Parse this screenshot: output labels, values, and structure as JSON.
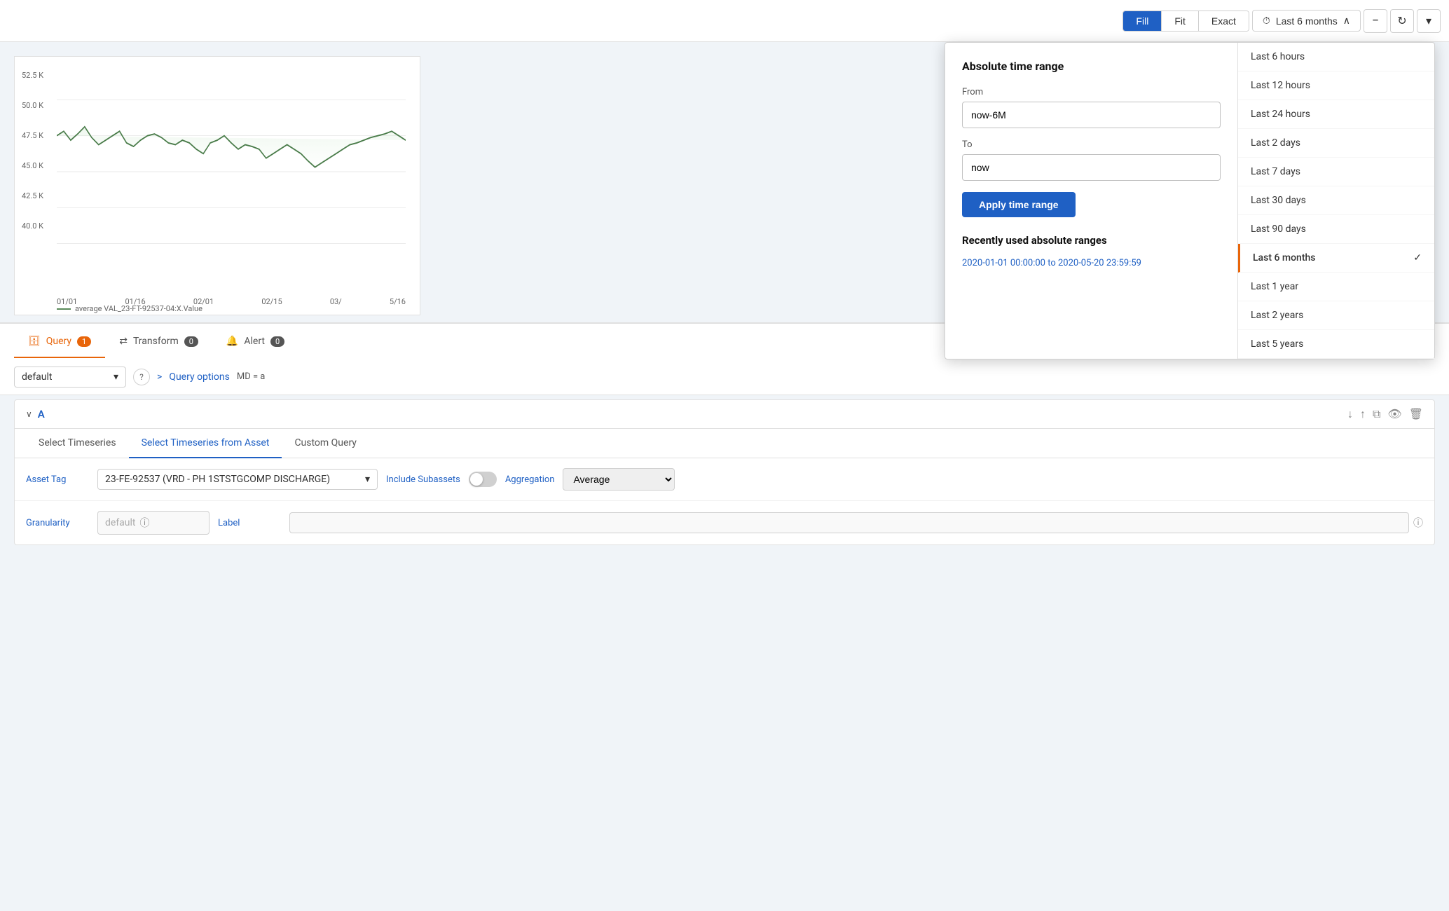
{
  "toolbar": {
    "fill_label": "Fill",
    "fit_label": "Fit",
    "exact_label": "Exact",
    "time_range_label": "Last 6 months",
    "zoom_out_icon": "−",
    "refresh_icon": "↻",
    "chevron_down_icon": "▾",
    "clock_icon": "⏱"
  },
  "chart": {
    "y_labels": [
      "52.5 K",
      "50.0 K",
      "47.5 K",
      "45.0 K",
      "42.5 K",
      "40.0 K"
    ],
    "x_labels": [
      "01/01",
      "01/16",
      "02/01",
      "02/15",
      "03/",
      "5/16"
    ],
    "legend_label": "average VAL_23-FT-92537-04:X.Value"
  },
  "tabs": {
    "query_label": "Query",
    "query_count": "1",
    "transform_label": "Transform",
    "transform_count": "0",
    "alert_label": "Alert",
    "alert_count": "0"
  },
  "query_bar": {
    "default_label": "default",
    "chevron_icon": "▾",
    "help_icon": "?",
    "arrow_icon": ">",
    "query_options_label": "Query options",
    "md_label": "MD = a"
  },
  "query_section": {
    "collapse_icon": "∨",
    "section_label": "A",
    "inner_tabs": [
      "Select Timeseries",
      "Select Timeseries from Asset",
      "Custom Query"
    ],
    "active_inner_tab": 1,
    "asset_tag_label": "Asset Tag",
    "asset_value": "23-FE-92537 (VRD - PH 1STSTGCOMP DISCHARGE)",
    "include_subassets_label": "Include Subassets",
    "aggregation_label": "Aggregation",
    "aggregation_value": "Average",
    "granularity_label": "Granularity",
    "granularity_placeholder": "default",
    "label_label": "Label",
    "label_placeholder": ""
  },
  "time_range_panel": {
    "absolute_title": "Absolute time range",
    "from_label": "From",
    "from_value": "now-6M",
    "to_label": "To",
    "to_value": "now",
    "apply_label": "Apply time range",
    "recently_used_title": "Recently used absolute ranges",
    "recent_range": "2020-01-01 00:00:00 to 2020-05-20 23:59:59",
    "quick_ranges": [
      {
        "label": "Last 6 hours",
        "active": false
      },
      {
        "label": "Last 12 hours",
        "active": false
      },
      {
        "label": "Last 24 hours",
        "active": false
      },
      {
        "label": "Last 2 days",
        "active": false
      },
      {
        "label": "Last 7 days",
        "active": false
      },
      {
        "label": "Last 30 days",
        "active": false
      },
      {
        "label": "Last 90 days",
        "active": false
      },
      {
        "label": "Last 6 months",
        "active": true
      },
      {
        "label": "Last 1 year",
        "active": false
      },
      {
        "label": "Last 2 years",
        "active": false
      },
      {
        "label": "Last 5 years",
        "active": false
      }
    ]
  }
}
